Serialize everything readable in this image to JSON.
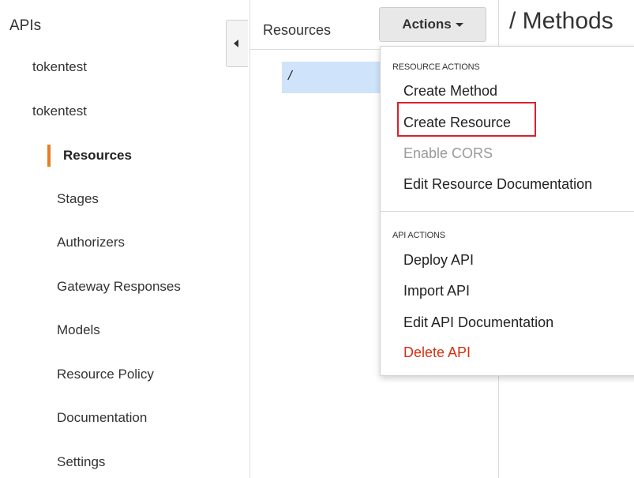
{
  "sidebar": {
    "title": "APIs",
    "apis": [
      "tokentest",
      "tokentest"
    ],
    "active_item": "Resources",
    "items": [
      "Stages",
      "Authorizers",
      "Gateway Responses",
      "Models",
      "Resource Policy",
      "Documentation",
      "Settings"
    ]
  },
  "resources_panel": {
    "title": "Resources",
    "selected_path": "/"
  },
  "actions_button": {
    "label": "Actions"
  },
  "page_title": "/ Methods",
  "menu": {
    "resource_header": "RESOURCE ACTIONS",
    "resource_items": [
      "Create Method",
      "Create Resource",
      "Enable CORS",
      "Edit Resource Documentation"
    ],
    "api_header": "API ACTIONS",
    "api_items": [
      "Deploy API",
      "Import API",
      "Edit API Documentation",
      "Delete API"
    ]
  },
  "colors": {
    "active_accent": "#e67e22",
    "selection_bg": "#cfe4fa",
    "danger": "#d13212",
    "highlight_border": "#d9212b"
  }
}
